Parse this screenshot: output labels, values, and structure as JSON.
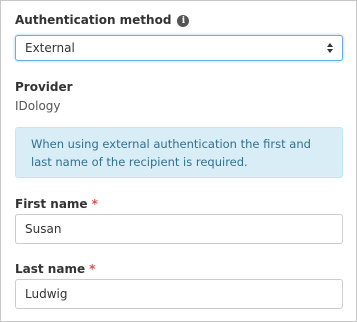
{
  "auth_method": {
    "label": "Authentication method",
    "info_icon": "i",
    "selected": "External"
  },
  "provider": {
    "label": "Provider",
    "value": "IDology"
  },
  "alert": {
    "text": "When using external authentication the first and last name of the recipient is required."
  },
  "first_name": {
    "label": "First name",
    "required_mark": "*",
    "value": "Susan"
  },
  "last_name": {
    "label": "Last name",
    "required_mark": "*",
    "value": "Ludwig"
  },
  "colors": {
    "alert_bg": "#d9edf7",
    "alert_text": "#31708f",
    "required": "#d9534f",
    "focus_border": "#66afe9"
  }
}
